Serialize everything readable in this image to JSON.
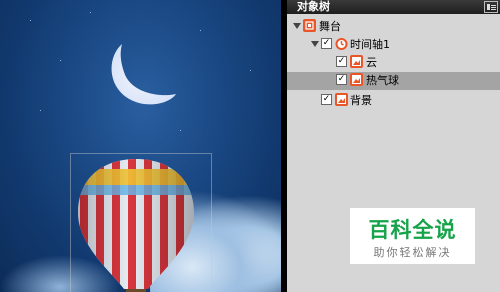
{
  "panel": {
    "title": "对象树"
  },
  "tree": [
    {
      "label": "舞台",
      "icon": "stage-icon",
      "expanded": true,
      "checkbox": false,
      "selected": false
    },
    {
      "label": "时间轴1",
      "icon": "timeline-icon",
      "expanded": true,
      "checkbox": true,
      "checked": true,
      "selected": false
    },
    {
      "label": "云",
      "icon": "image-icon",
      "checkbox": true,
      "checked": true,
      "selected": false
    },
    {
      "label": "热气球",
      "icon": "image-icon",
      "checkbox": true,
      "checked": true,
      "selected": true
    },
    {
      "label": "背景",
      "icon": "image-icon",
      "checkbox": true,
      "checked": true,
      "selected": false
    }
  ],
  "watermark": {
    "title": "百科全说",
    "subtitle": "助你轻松解决"
  },
  "colors": {
    "accent_icon": "#e8562a",
    "selected_row": "#a4a4a4",
    "panel_bg": "#d6d6d6",
    "watermark_green": "#16a34a"
  }
}
